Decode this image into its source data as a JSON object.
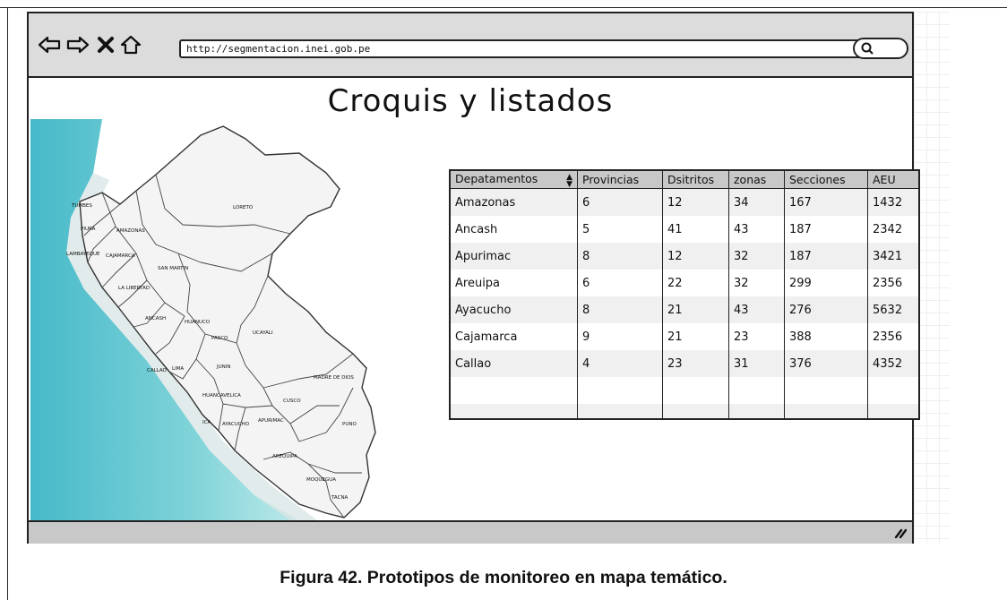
{
  "browser": {
    "url": "http://segmentacion.inei.gob.pe",
    "icons": [
      "back-arrow-icon",
      "forward-arrow-icon",
      "close-icon",
      "home-icon",
      "search-icon",
      "resize-handle-icon"
    ]
  },
  "page": {
    "title": "Croquis y listados"
  },
  "map": {
    "labels": {
      "tumbes": "TUMBES",
      "piura": "PIURA",
      "amazonas": "AMAZONAS",
      "lambayeque": "LAMBAYEQUE",
      "cajamarca": "CAJAMARCA",
      "loreto": "LORETO",
      "san_martin": "SAN MARTIN",
      "la_libertad": "LA LIBERTAD",
      "ancash": "ANCASH",
      "huanuco": "HUANUCO",
      "pasco": "PASCO",
      "ucayali": "UCAYALI",
      "callao": "CALLAO",
      "lima": "LIMA",
      "junin": "JUNIN",
      "madre_de_dios": "MADRE DE DIOS",
      "huancavelica": "HUANCAVELICA",
      "cusco": "CUSCO",
      "ica": "ICA",
      "ayacucho": "AYACUCHO",
      "apurimac": "APURIMAC",
      "puno": "PUNO",
      "arequipa": "AREQUIPA",
      "moquegua": "MOQUEGUA",
      "tacna": "TACNA"
    },
    "colors": {
      "ocean": "#5fc4cf",
      "land": "#f5f5f5",
      "border": "#333333"
    }
  },
  "table": {
    "headers": [
      "Depatamentos",
      "Provincias",
      "Dsitritos",
      "zonas",
      "Secciones",
      "AEU"
    ],
    "rows": [
      [
        "Amazonas",
        "6",
        "12",
        "34",
        "167",
        "1432"
      ],
      [
        "Ancash",
        "5",
        "41",
        "43",
        "187",
        "2342"
      ],
      [
        "Apurimac",
        "8",
        "12",
        "32",
        "187",
        "3421"
      ],
      [
        "Areuipa",
        "6",
        "22",
        "32",
        "299",
        "2356"
      ],
      [
        "Ayacucho",
        "8",
        "21",
        "43",
        "276",
        "5632"
      ],
      [
        "Cajamarca",
        "9",
        "21",
        "23",
        "388",
        "2356"
      ],
      [
        "Callao",
        "4",
        "23",
        "31",
        "376",
        "4352"
      ],
      [
        "",
        "",
        "",
        "",
        "",
        ""
      ],
      [
        "",
        "",
        "",
        "",
        "",
        ""
      ]
    ]
  },
  "caption": "Figura 42. Prototipos de monitoreo en mapa temático."
}
